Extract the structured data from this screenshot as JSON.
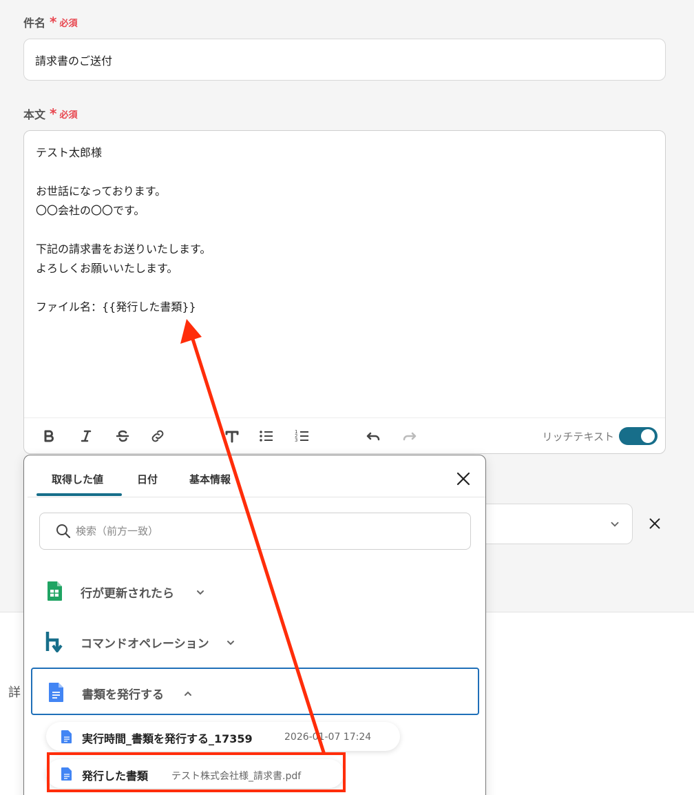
{
  "subject": {
    "label": "件名",
    "required_star": "*",
    "required_text": "必須",
    "value": "請求書のご送付"
  },
  "body": {
    "label": "本文",
    "required_star": "*",
    "required_text": "必須",
    "lines": [
      "テスト太郎様",
      "",
      "お世話になっております。",
      "〇〇会社の〇〇です。",
      "",
      "下記の請求書をお送りいたします。",
      "よろしくお願いいたします。",
      "",
      "ファイル名：{{発行した書類}}"
    ]
  },
  "toolbar": {
    "rich_text_label": "リッチテキスト",
    "rich_text_enabled": true
  },
  "popup": {
    "tabs": [
      "取得した値",
      "日付",
      "基本情報"
    ],
    "active_tab": 0,
    "search_placeholder": "検索（前方一致）",
    "groups": [
      {
        "label": "行が更新されたら",
        "icon": "google-sheets-icon",
        "expanded": false
      },
      {
        "label": "コマンドオペレーション",
        "icon": "command-operation-icon",
        "expanded": false
      },
      {
        "label": "書類を発行する",
        "icon": "google-docs-icon",
        "expanded": true
      }
    ],
    "items": [
      {
        "name": "実行時間_書類を発行する_17359",
        "value": "2026-01-07 17:24"
      },
      {
        "name": "発行した書類",
        "value": "テスト株式会社様_請求書.pdf"
      }
    ]
  },
  "background": {
    "detail_label_partial": "詳"
  },
  "colors": {
    "accent": "#176e8a",
    "required": "#e8464f",
    "annotation": "#ff2d0a",
    "active_border": "#1f6fb8"
  }
}
